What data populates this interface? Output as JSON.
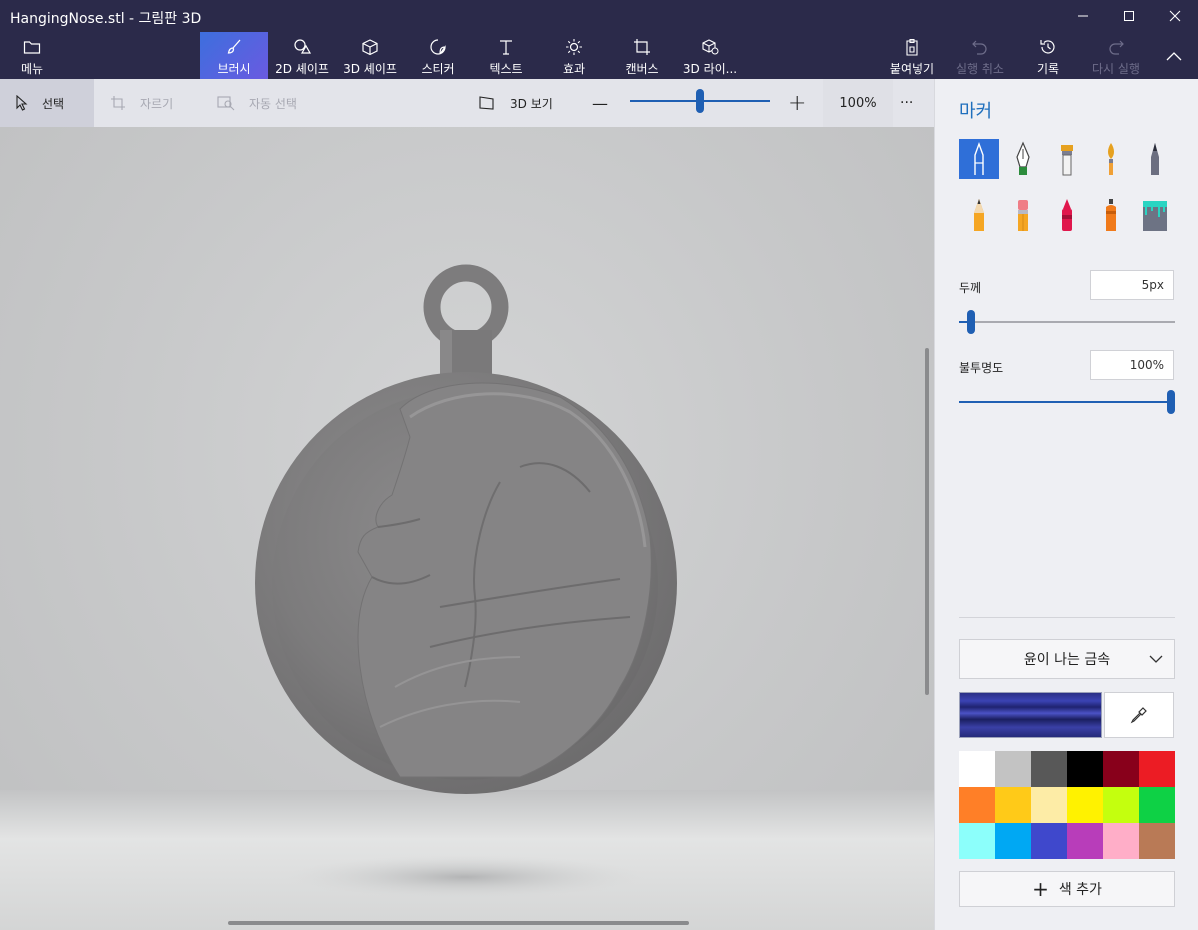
{
  "window": {
    "title": "HangingNose.stl - 그림판 3D",
    "controls": {
      "minimize": "minimize-icon",
      "maximize": "maximize-icon",
      "close": "close-icon"
    }
  },
  "ribbon": {
    "menu_label": "메뉴",
    "tabs": [
      {
        "label": "브러시",
        "icon": "brush-icon",
        "active": true
      },
      {
        "label": "2D 셰이프",
        "icon": "shapes-2d-icon"
      },
      {
        "label": "3D 셰이프",
        "icon": "cube-icon"
      },
      {
        "label": "스티커",
        "icon": "sticker-icon"
      },
      {
        "label": "텍스트",
        "icon": "text-icon"
      },
      {
        "label": "효과",
        "icon": "sun-icon"
      },
      {
        "label": "캔버스",
        "icon": "canvas-icon"
      },
      {
        "label": "3D 라이...",
        "icon": "library-3d-icon"
      }
    ],
    "actions": [
      {
        "label": "붙여넣기",
        "icon": "paste-icon",
        "enabled": true
      },
      {
        "label": "실행 취소",
        "icon": "undo-icon",
        "enabled": false
      },
      {
        "label": "기록",
        "icon": "history-icon",
        "enabled": true
      },
      {
        "label": "다시 실행",
        "icon": "redo-icon",
        "enabled": false
      }
    ],
    "collapse_icon": "chevron-up-icon"
  },
  "subtoolbar": {
    "select_label": "선택",
    "crop_label": "자르기",
    "magic_select_label": "자동 선택",
    "view3d_label": "3D 보기",
    "zoom_minus": "—",
    "zoom_plus": "+",
    "zoom_value": "100%",
    "zoom_fraction": 0.5,
    "more_label": "···"
  },
  "panel": {
    "title": "마커",
    "tools": [
      {
        "name": "marker-icon",
        "active": true
      },
      {
        "name": "calligraphy-pen-icon"
      },
      {
        "name": "oil-brush-icon"
      },
      {
        "name": "watercolor-icon"
      },
      {
        "name": "pixel-pen-icon"
      },
      {
        "name": "pencil-icon"
      },
      {
        "name": "eraser-icon"
      },
      {
        "name": "crayon-icon"
      },
      {
        "name": "spray-can-icon"
      },
      {
        "name": "fill-bucket-icon"
      }
    ],
    "thickness": {
      "label": "두께",
      "value": "5px",
      "fraction": 0.05
    },
    "opacity": {
      "label": "불투명도",
      "value": "100%",
      "fraction": 1.0
    },
    "material": {
      "label": "윤이 나는 금속"
    },
    "current_color": "#2f3599",
    "eyedropper_icon": "eyedropper-icon",
    "palette": [
      "#ffffff",
      "#c3c3c3",
      "#585858",
      "#000000",
      "#88001b",
      "#ec1c24",
      "#ff7f27",
      "#ffca18",
      "#fdeca6",
      "#fff200",
      "#c4ff0e",
      "#0ed145",
      "#8cfffb",
      "#00a8f3",
      "#3f48cc",
      "#b83dba",
      "#ffaec8",
      "#b97a56"
    ],
    "add_color_label": "색 추가"
  }
}
